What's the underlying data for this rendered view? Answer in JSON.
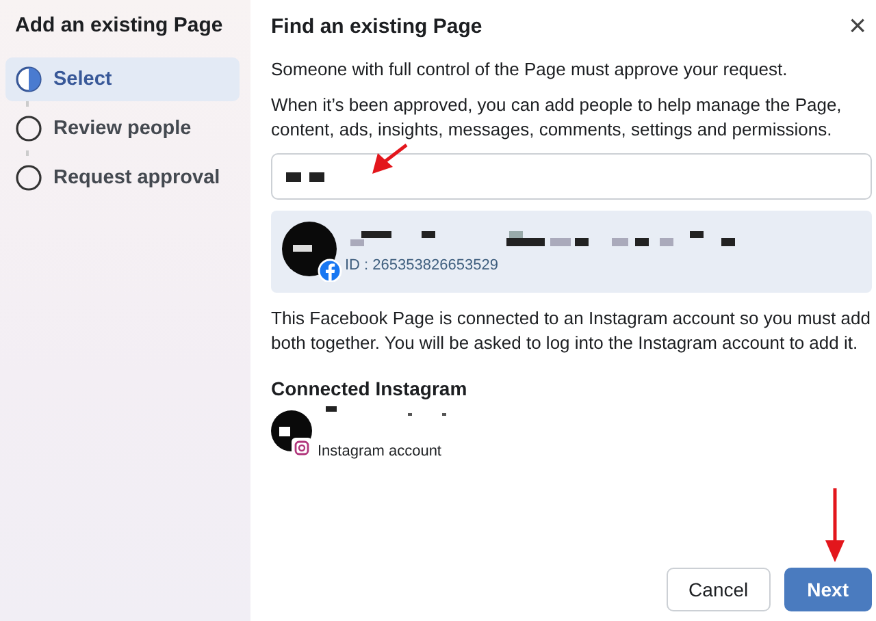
{
  "sidebar": {
    "title": "Add an existing Page",
    "steps": [
      {
        "label": "Select",
        "selected": true
      },
      {
        "label": "Review people",
        "selected": false
      },
      {
        "label": "Request approval",
        "selected": false
      }
    ]
  },
  "dialog": {
    "title": "Find an existing Page",
    "close": "×",
    "paragraphs": [
      "Someone with full control of the Page must approve your request.",
      "When it’s been approved, you can add people to help manage the Page, content, ads, insights, messages, comments, settings and permissions."
    ],
    "result": {
      "id": "ID : 265353826653529"
    },
    "notice": "This Facebook Page is connected to an Instagram account so you must add both together. You will be asked to log into the Instagram account to add it.",
    "connected_heading": "Connected Instagram",
    "instagram": {
      "subtitle": "Instagram account"
    },
    "buttons": [
      {
        "label": "Cancel",
        "kind": "secondary"
      },
      {
        "label": "Next",
        "kind": "primary"
      }
    ]
  }
}
